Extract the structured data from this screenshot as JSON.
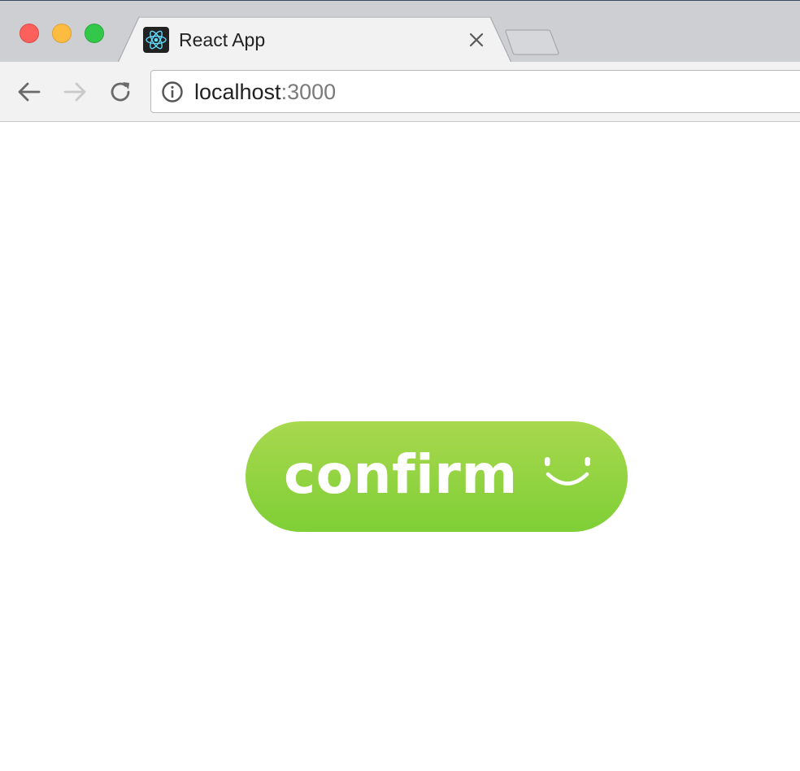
{
  "browser": {
    "tab": {
      "title": "React App",
      "favicon": "react-logo-icon",
      "close_icon": "close-icon"
    },
    "new_tab_icon": "new-tab-icon",
    "toolbar": {
      "back_icon": "back-arrow-icon",
      "forward_icon": "forward-arrow-icon",
      "reload_icon": "reload-icon",
      "info_icon": "info-icon",
      "address": {
        "host": "localhost",
        "port": ":3000"
      }
    },
    "colors": {
      "close": "#fc605c",
      "minimize": "#fdbc40",
      "maximize": "#34c84a"
    }
  },
  "page": {
    "confirm_button": {
      "label": "confirm",
      "icon": "smile-icon",
      "gradient_top": "#a8d84e",
      "gradient_bottom": "#7fcf36"
    }
  }
}
